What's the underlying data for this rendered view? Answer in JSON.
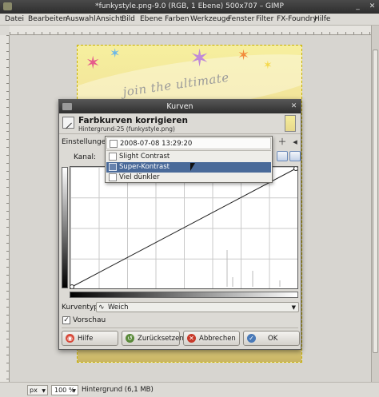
{
  "window": {
    "title": "*funkystyle.png-9.0 (RGB, 1 Ebene) 500x707 – GIMP"
  },
  "menubar": [
    "Datei",
    "Bearbeiten",
    "Auswahl",
    "Ansicht",
    "Bild",
    "Ebene",
    "Farben",
    "Werkzeuge",
    "Fenster",
    "Filter",
    "FX-Foundry",
    "Hilfe"
  ],
  "canvas": {
    "slogan": "join the ultimate"
  },
  "statusbar": {
    "unit": "px",
    "zoom": "100 %",
    "message": "Hintergrund (6,1 MB)"
  },
  "dialog": {
    "title": "Kurven",
    "heading": "Farbkurven korrigieren",
    "subheading": "Hintergrund-25 (funkystyle.png)",
    "settings_label": "Einstellungen:",
    "channel_label": "Kanal:",
    "curve_type_label": "Kurventyp:",
    "curve_type_value": "Weich",
    "preview_label": "Vorschau",
    "preview_checked": true,
    "buttons": {
      "help": "Hilfe",
      "reset": "Zurücksetzen",
      "cancel": "Abbrechen",
      "ok": "OK"
    }
  },
  "presets_popup": {
    "current": "2008-07-08 13:29:20",
    "items": [
      {
        "label": "Slight Contrast",
        "selected": false
      },
      {
        "label": "Super-Kontrast",
        "selected": true
      },
      {
        "label": "Viel dünkler",
        "selected": false
      }
    ]
  },
  "icons": {
    "close": "close-icon",
    "curve_type": "curve-icon",
    "help": "help-lifebuoy-icon",
    "reset": "reset-icon",
    "cancel": "cancel-icon",
    "ok": "ok-check-icon"
  },
  "colors": {
    "selection": "#4a6a99",
    "titlebar": "#2f2f2f",
    "dialog_bg": "#dcdad5"
  }
}
